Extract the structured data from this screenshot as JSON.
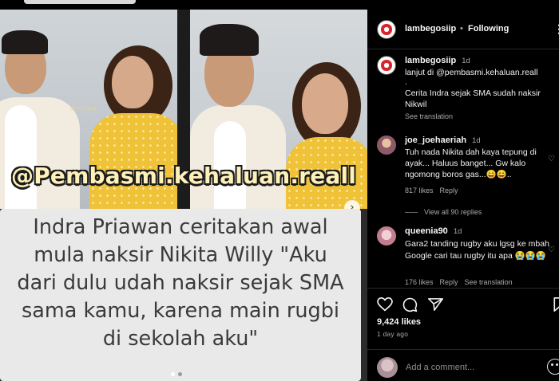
{
  "media": {
    "caption_tag": "demi apa",
    "watermark": "@Pembasmi.kehaluan.reall",
    "next_glyph": "›",
    "quote_lines": [
      "Indra Priawan ceritakan awal",
      "mula naksir Nikita Willy \"Aku",
      "dari dulu udah naksir sejak SMA",
      "sama kamu, karena main rugbi",
      "di sekolah aku\""
    ]
  },
  "header": {
    "username": "lambegosiip",
    "separator": "•",
    "follow_label": "Following",
    "more_glyph": "⋮"
  },
  "post_caption": {
    "username": "lambegosiip",
    "time": "1d",
    "lines": [
      "lanjut di @pembasmi.kehaluan.reall",
      ".",
      "Cerita Indra sejak SMA sudah naksir",
      "Nikwil"
    ],
    "see_translation": "See translation"
  },
  "comments": [
    {
      "username": "joe_joehaeriah",
      "time": "1d",
      "lines": [
        "Tuh nada Nikita dah kaya tepung di",
        "ayak... Haluus banget... Gw kalo",
        "ngomong boros gas...😄😄.."
      ],
      "likes": "817 likes",
      "reply": "Reply",
      "view_replies": "View all 90 replies"
    },
    {
      "username": "queenia90",
      "time": "1d",
      "lines": [
        "Gara2 tanding rugby aku lgsg ke mbah",
        "Google cari tau rugby itu apa 😭😭😭"
      ],
      "likes": "176 likes",
      "reply": "Reply",
      "see_translation": "See translation"
    }
  ],
  "post": {
    "likes": "9,424 likes",
    "ago": "1 day ago",
    "add_comment_placeholder": "Add a comment..."
  },
  "colors": {
    "background": "#000000",
    "text_primary": "#f5f5f5",
    "text_secondary": "#a8a8a8",
    "watermark_fill": "#fdf0b8",
    "quote_bg": "#e9e9e9",
    "dress": "#f0c238"
  },
  "icons": {
    "heart": "heart-icon",
    "comment": "comment-icon",
    "share": "paper-plane-icon",
    "bookmark": "bookmark-icon",
    "emoji": "emoji-icon",
    "more": "more-icon",
    "next": "chevron-right-icon"
  }
}
